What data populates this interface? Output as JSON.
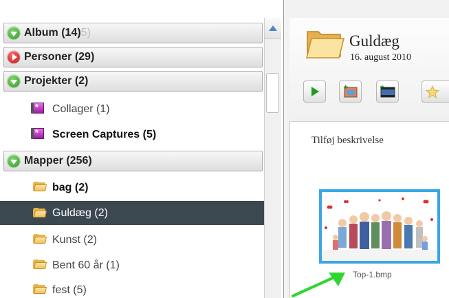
{
  "sidebar": {
    "sections": [
      {
        "label": "Album (14)",
        "ghost": "5)",
        "state": "expanded"
      },
      {
        "label": "Personer (29)",
        "state": "collapsed"
      },
      {
        "label": "Projekter (2)",
        "state": "expanded"
      },
      {
        "label": "Mapper (256)",
        "state": "expanded"
      }
    ],
    "projects": [
      {
        "label": "Collager (1)",
        "icon": "collage-icon"
      },
      {
        "label": "Screen Captures (5)",
        "icon": "collage-icon"
      }
    ],
    "folders": [
      {
        "label": "bag (2)",
        "icon": "folder-icon"
      },
      {
        "label": "Guldæg (2)",
        "icon": "folder-icon",
        "selected": true
      },
      {
        "label": "Kunst (2)",
        "icon": "folder-icon"
      },
      {
        "label": "Bent 60 år (1)",
        "icon": "folder-icon"
      },
      {
        "label": "fest (5)",
        "icon": "folder-icon"
      }
    ]
  },
  "album": {
    "title": "Guldæg",
    "date": "16. august 2010",
    "description_placeholder": "Tilføj beskrivelse",
    "thumbnail_caption": "Top-1.bmp"
  },
  "toolbar": {
    "buttons": [
      "play-icon",
      "add-photo-icon",
      "add-movie-icon",
      "star-icon"
    ]
  },
  "colors": {
    "selection_bg": "#3c4850",
    "thumb_border": "#3aa6e6",
    "annotation_arrow": "#2fd62f"
  }
}
